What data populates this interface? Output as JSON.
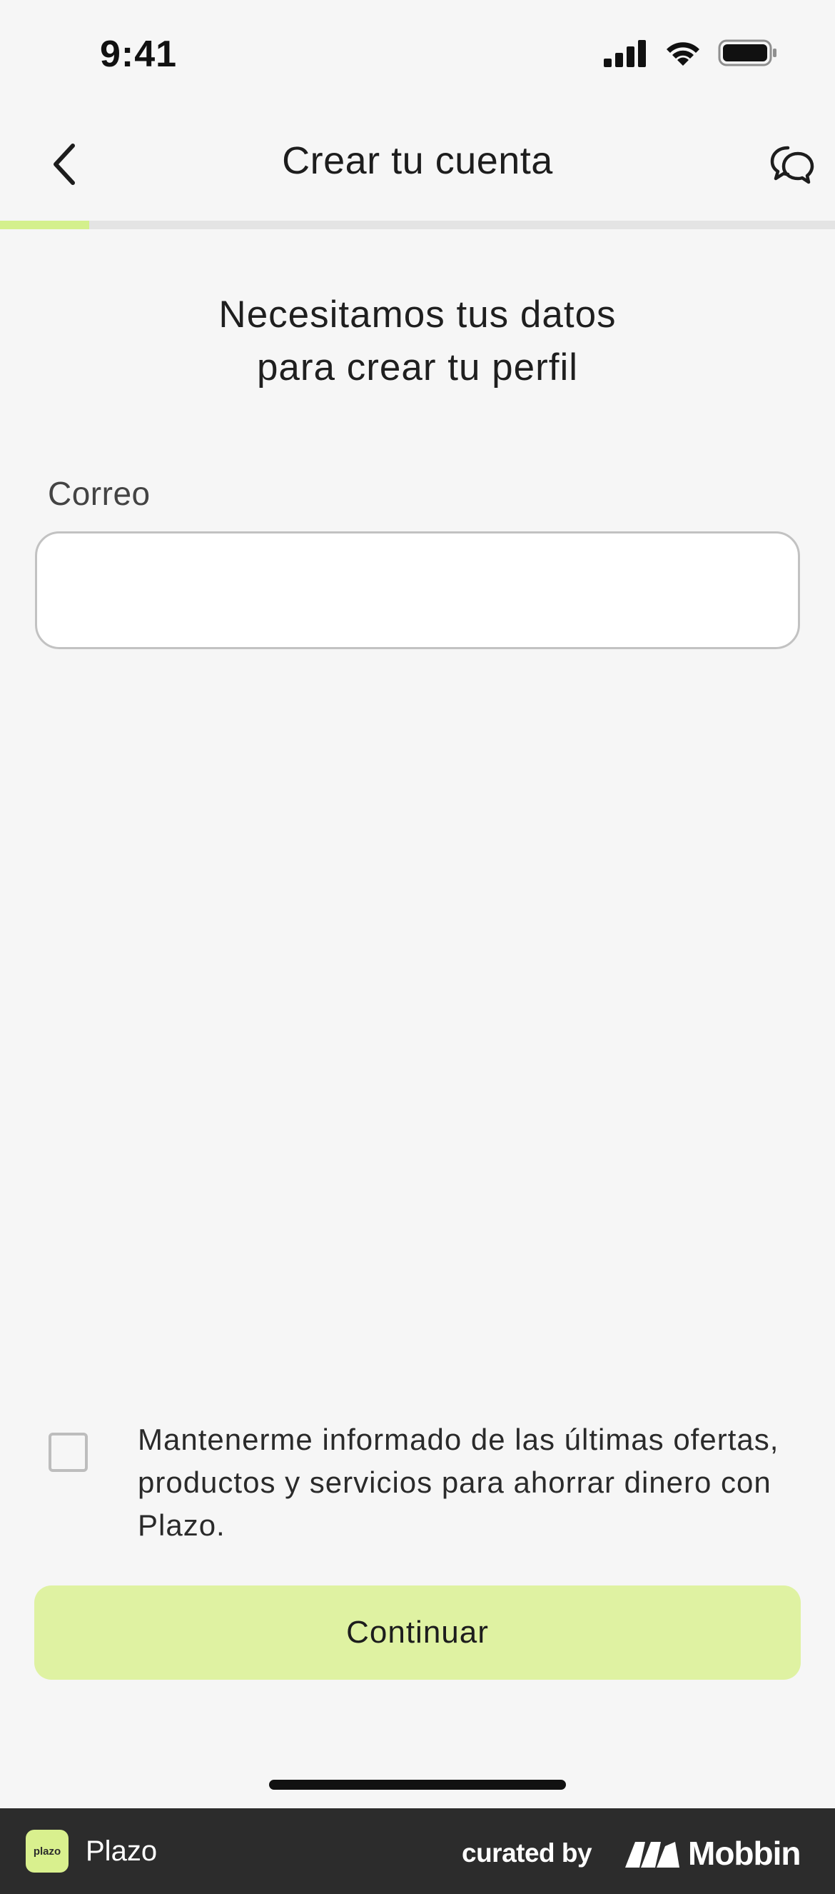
{
  "status_bar": {
    "time": "9:41"
  },
  "nav": {
    "title": "Crear tu cuenta"
  },
  "progress": {
    "value": 0.107
  },
  "heading": {
    "line1": "Necesitamos tus datos",
    "line2": "para crear tu perfil"
  },
  "form": {
    "email_label": "Correo",
    "email_value": "",
    "email_placeholder": ""
  },
  "consent": {
    "checked": false,
    "label": "Mantenerme informado de las últimas ofertas, productos y servicios para ahorrar dinero con Plazo."
  },
  "actions": {
    "continue_label": "Continuar"
  },
  "footer": {
    "app_logo_text": "plazo",
    "app_name": "Plazo",
    "curated_by": "curated by",
    "brand": "Mobbin"
  },
  "colors": {
    "accent": "#d4f08c",
    "button_bg": "#dff2a2",
    "background": "#f6f6f6",
    "footer_bg": "#2c2c2c"
  },
  "icons": {
    "back": "chevron-left-icon",
    "chat": "chat-bubbles-icon",
    "signal": "signal-icon",
    "wifi": "wifi-icon",
    "battery": "battery-icon"
  }
}
